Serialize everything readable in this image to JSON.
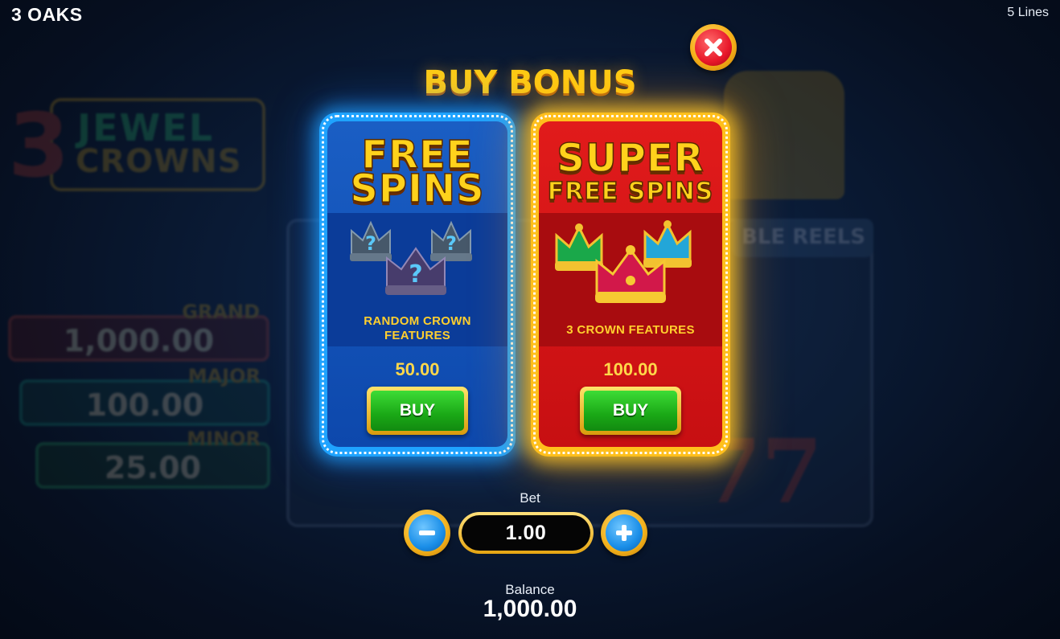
{
  "header": {
    "brand": "3 OAKS",
    "lines": "5 Lines"
  },
  "background": {
    "logo_number": "3",
    "logo_line1": "JEWEL",
    "logo_line2": "CROWNS",
    "reel_banner": "BLE REELS",
    "jackpots": [
      {
        "label": "GRAND",
        "value": "1,000.00"
      },
      {
        "label": "MAJOR",
        "value": "100.00"
      },
      {
        "label": "MINOR",
        "value": "25.00"
      }
    ]
  },
  "modal": {
    "title": "BUY BONUS",
    "options": [
      {
        "heading_line1": "FREE",
        "heading_line2": "SPINS",
        "feature_line1": "RANDOM CROWN",
        "feature_line2": "FEATURES",
        "price": "50.00",
        "button_label": "BUY",
        "theme": {
          "frame": "#1fa3ff",
          "panel": "#1a5ec4"
        }
      },
      {
        "heading_line1": "SUPER",
        "heading_line2": "FREE SPINS",
        "feature_line1": "3 CROWN FEATURES",
        "price": "100.00",
        "button_label": "BUY",
        "theme": {
          "frame": "#ffbf1c",
          "panel": "#e11b1b"
        }
      }
    ]
  },
  "bet": {
    "label": "Bet",
    "value": "1.00"
  },
  "balance": {
    "label": "Balance",
    "value": "1,000.00"
  },
  "icons": {
    "close": "close-icon",
    "minus": "minus-icon",
    "plus": "plus-icon",
    "crown": "crown-icon",
    "mystery": "question-mark-icon"
  },
  "colors": {
    "accent_gold": "#ffcc14",
    "buy_green": "#1aa816",
    "close_red": "#e8192b",
    "stepper_blue": "#1a8ee8"
  }
}
